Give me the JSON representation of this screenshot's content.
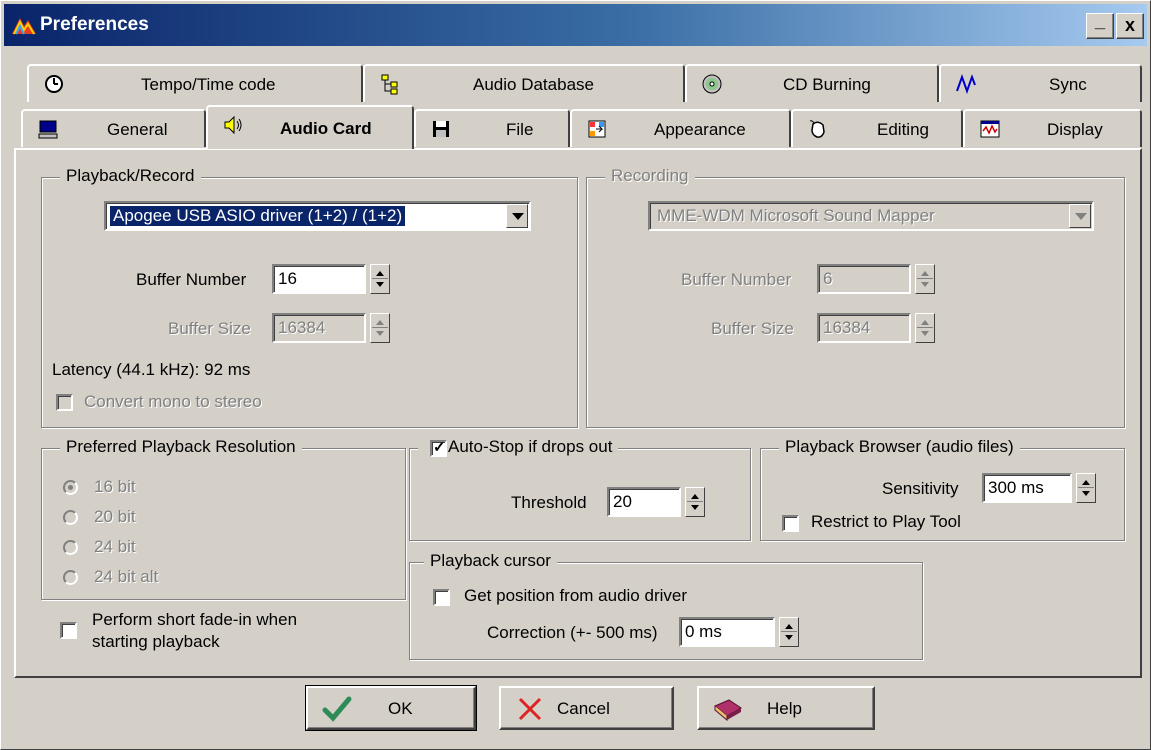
{
  "window": {
    "title": "Preferences",
    "minimize_label": "_",
    "close_label": "x"
  },
  "tabs_row1": [
    {
      "label": "Tempo/Time code",
      "icon": "clock-icon"
    },
    {
      "label": "Audio Database",
      "icon": "database-tree-icon"
    },
    {
      "label": "CD Burning",
      "icon": "cd-icon"
    },
    {
      "label": "Sync",
      "icon": "sync-wave-icon"
    }
  ],
  "tabs_row2": [
    {
      "label": "General",
      "icon": "computer-icon"
    },
    {
      "label": "Audio Card",
      "icon": "speaker-icon",
      "active": true
    },
    {
      "label": "File",
      "icon": "floppy-disk-icon"
    },
    {
      "label": "Appearance",
      "icon": "appearance-icon"
    },
    {
      "label": "Editing",
      "icon": "mouse-icon"
    },
    {
      "label": "Display",
      "icon": "display-waveform-icon"
    }
  ],
  "playback_record": {
    "title": "Playback/Record",
    "driver": "Apogee USB ASIO driver (1+2) / (1+2)",
    "buffer_number_label": "Buffer Number",
    "buffer_number": "16",
    "buffer_size_label": "Buffer Size",
    "buffer_size": "16384",
    "latency": "Latency (44.1 kHz): 92 ms",
    "convert_mono_label": "Convert mono to stereo"
  },
  "recording": {
    "title": "Recording",
    "driver": "MME-WDM Microsoft Sound Mapper",
    "buffer_number_label": "Buffer Number",
    "buffer_number": "6",
    "buffer_size_label": "Buffer Size",
    "buffer_size": "16384"
  },
  "resolution": {
    "title": "Preferred Playback Resolution",
    "options": [
      "16 bit",
      "20 bit",
      "24 bit",
      "24 bit alt"
    ],
    "selected": "16 bit"
  },
  "fade_in_label_line1": "Perform short fade-in when",
  "fade_in_label_line2": "starting playback",
  "autostop": {
    "label": "Auto-Stop if drops out",
    "checked": true,
    "threshold_label": "Threshold",
    "threshold": "20"
  },
  "browser": {
    "title": "Playback Browser (audio files)",
    "sensitivity_label": "Sensitivity",
    "sensitivity": "300 ms",
    "restrict_label": "Restrict to Play Tool"
  },
  "cursor_group": {
    "title": "Playback cursor",
    "get_position_label": "Get position from audio driver",
    "correction_label": "Correction (+- 500 ms)",
    "correction": "0 ms"
  },
  "buttons": {
    "ok": "OK",
    "cancel": "Cancel",
    "help": "Help"
  },
  "colors": {
    "face": "#d4d0c8",
    "title_start": "#0a246a",
    "title_end": "#a6caf0",
    "ok_check": "#2e8b57",
    "cancel_x": "#d22",
    "help_book": "#b0306a"
  }
}
